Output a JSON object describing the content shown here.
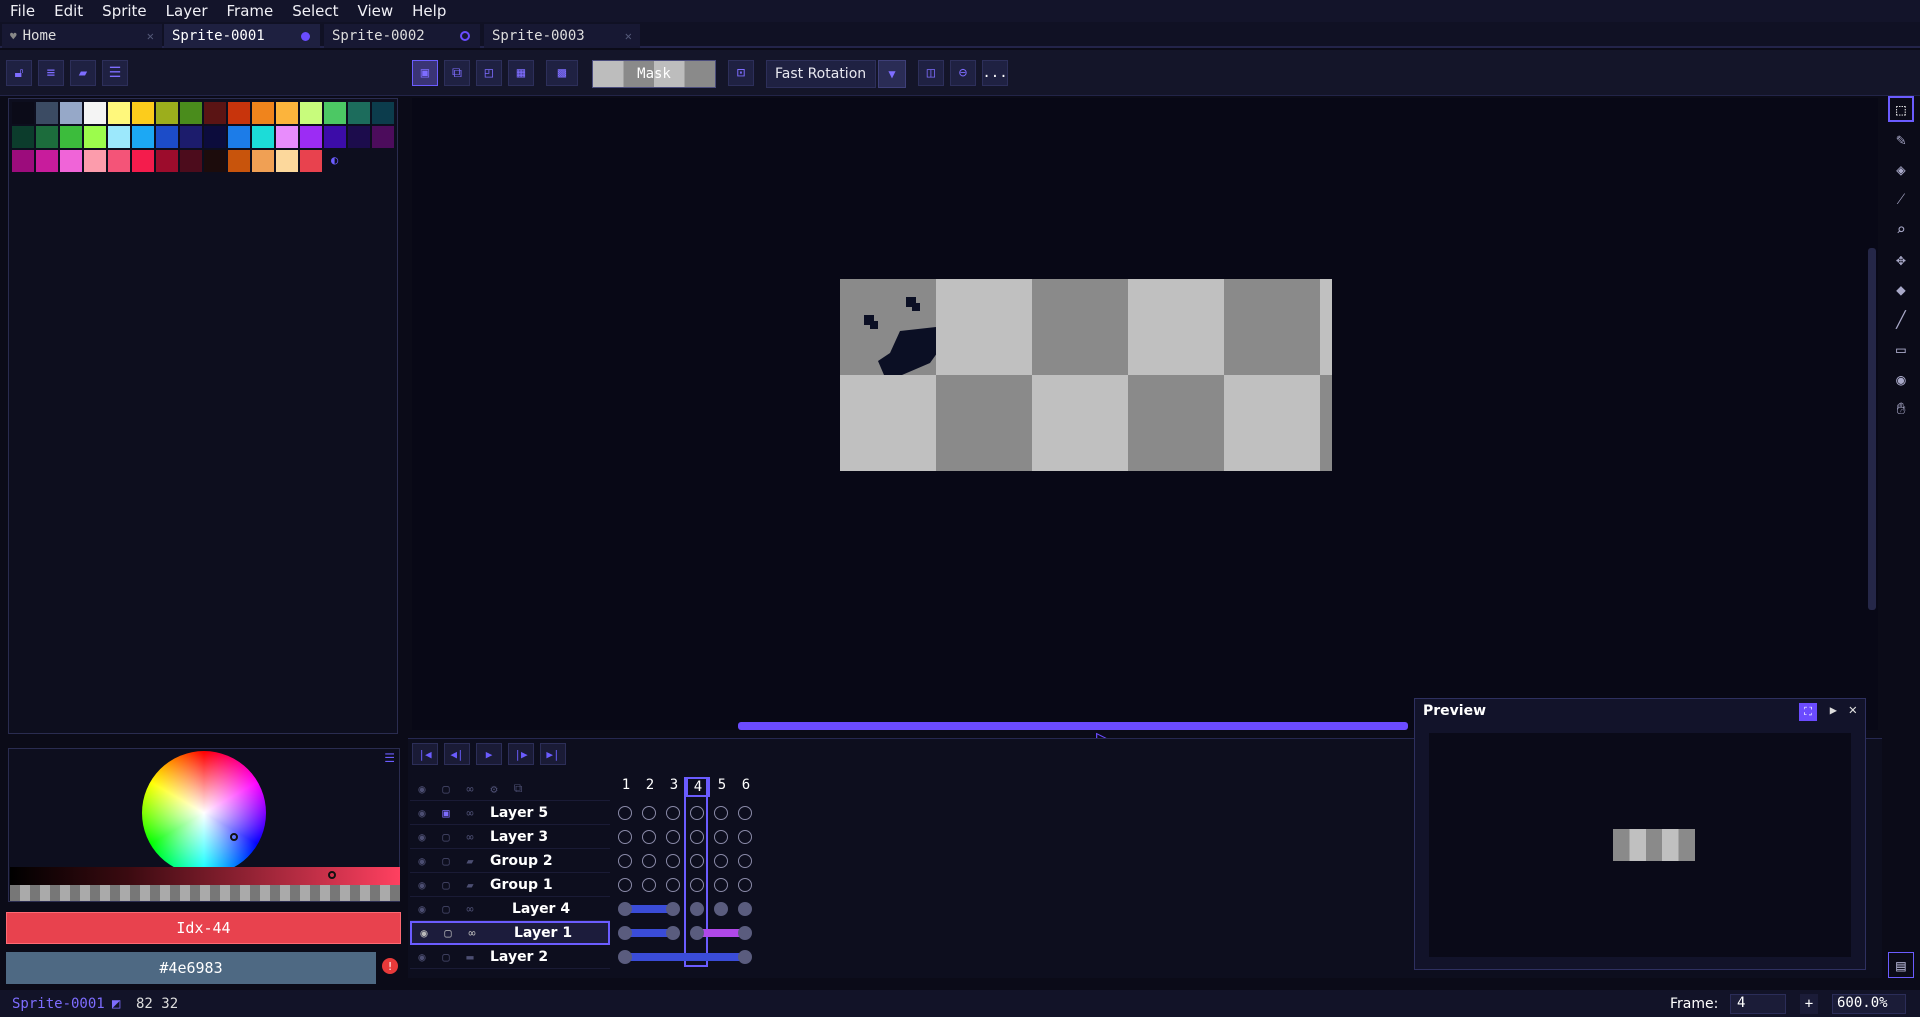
{
  "menu": [
    "File",
    "Edit",
    "Sprite",
    "Layer",
    "Frame",
    "Select",
    "View",
    "Help"
  ],
  "tabs": [
    {
      "label": "Home",
      "state": "close"
    },
    {
      "label": "Sprite-0001",
      "state": "modified"
    },
    {
      "label": "Sprite-0002",
      "state": "ring"
    },
    {
      "label": "Sprite-0003",
      "state": "close"
    }
  ],
  "toolbar": {
    "mask_label": "Mask",
    "rotation_label": "Fast Rotation",
    "more_label": "..."
  },
  "palette": [
    "#0b0b18",
    "#3b4b63",
    "#96a8c8",
    "#f4f4f4",
    "#fff87c",
    "#fccc1c",
    "#9cae1c",
    "#4a8c1c",
    "#5a1414",
    "#c8340c",
    "#f0841c",
    "#fcb43c",
    "#c8fc7c",
    "#4cc864",
    "#1c6c5c",
    "#0c3c4c",
    "#0c3c2c",
    "#1c6c3c",
    "#3cbc3c",
    "#9cfc4c",
    "#9ce8fc",
    "#1ca8f4",
    "#1c4cc8",
    "#1c1c6c",
    "#0c0c3c",
    "#1c7ce8",
    "#1cdcd8",
    "#e88cfc",
    "#9c2cf4",
    "#3c0ca8",
    "#1c0c4c",
    "#4c0c5c",
    "#9c0c7c",
    "#c81c9c",
    "#f064d8",
    "#fc9cac",
    "#f45478",
    "#f41c4c",
    "#9c0c2c",
    "#4c0c1c",
    "#1c0c0c",
    "#c8540c",
    "#f0a054",
    "#fcd89c",
    "#e8424e"
  ],
  "color": {
    "index_label": "Idx-44",
    "hex_label": "#4e6983",
    "fg": "#e8424e",
    "bg": "#4e6983"
  },
  "timeline": {
    "frames": [
      "1",
      "2",
      "3",
      "4",
      "5",
      "6"
    ],
    "current_frame": "4",
    "layers": [
      {
        "name": "Layer 5"
      },
      {
        "name": "Layer 3"
      },
      {
        "name": "Group 2"
      },
      {
        "name": "Group 1"
      },
      {
        "name": "Layer 4"
      },
      {
        "name": "Layer 1"
      },
      {
        "name": "Layer 2"
      }
    ]
  },
  "preview": {
    "title": "Preview"
  },
  "status": {
    "sprite_name": "Sprite-0001",
    "size": "82 32",
    "frame_label": "Frame:",
    "frame_value": "4",
    "plus": "+",
    "zoom": "600.0%"
  },
  "icons": {
    "tools": [
      "marquee-icon",
      "pencil-icon",
      "eraser-icon",
      "eyedropper-icon",
      "zoom-icon",
      "move-icon",
      "bucket-icon",
      "line-icon",
      "rectangle-icon",
      "blur-icon",
      "hand-icon"
    ]
  }
}
